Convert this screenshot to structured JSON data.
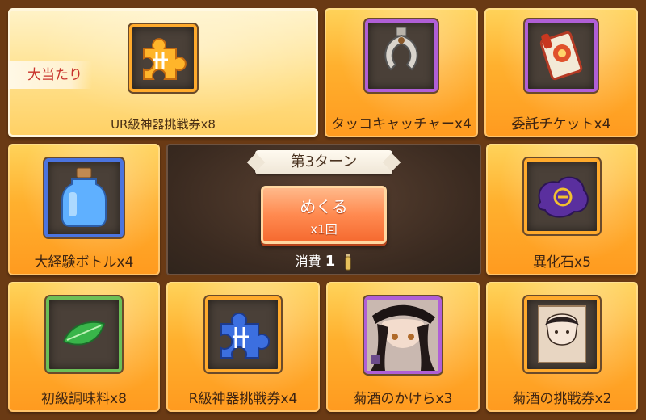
{
  "featured_badge": "大当たり",
  "rewards": [
    {
      "label": "UR級神器挑戦券x8",
      "icon": "orange-puzzle-piece-icon",
      "rarity_color": "#ff9b2b"
    },
    {
      "label": "タッコキャッチャーx4",
      "icon": "claw-catcher-icon",
      "rarity_color": "#b05fd6"
    },
    {
      "label": "委託チケットx4",
      "icon": "scroll-ticket-icon",
      "rarity_color": "#b05fd6"
    },
    {
      "label": "大経験ボトルx4",
      "icon": "exp-bottle-icon",
      "rarity_color": "#4b74df"
    },
    {
      "label": "異化石x5",
      "icon": "purple-slime-stone-icon",
      "rarity_color": "#ffaa2c"
    },
    {
      "label": "初級調味料x8",
      "icon": "green-leaf-icon",
      "rarity_color": "#6cbf57"
    },
    {
      "label": "R級神器挑戦券x4",
      "icon": "blue-puzzle-piece-icon",
      "rarity_color": "#ffaa2c"
    },
    {
      "label": "菊酒のかけらx3",
      "icon": "character-portrait-icon",
      "rarity_color": "#b05fd6"
    },
    {
      "label": "菊酒の挑戦券x2",
      "icon": "character-sketch-icon",
      "rarity_color": "#ffaa2c"
    }
  ],
  "center": {
    "turn": "第3ターン",
    "button_label": "めくる",
    "button_count": "x1回",
    "cost_label": "消費",
    "cost_value": "1"
  }
}
